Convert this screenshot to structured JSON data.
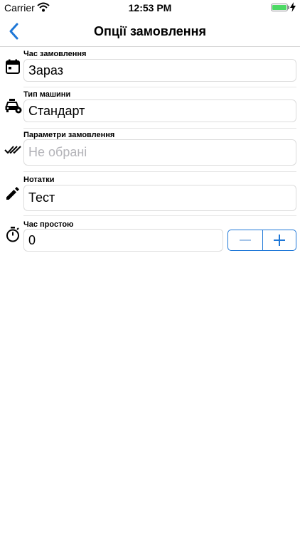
{
  "status_bar": {
    "carrier": "Carrier",
    "time": "12:53 PM"
  },
  "nav": {
    "title": "Опції замовлення",
    "back_icon": "chevron-left-icon"
  },
  "rows": [
    {
      "icon": "calendar-icon",
      "label": "Час замовлення",
      "value": "Зараз"
    },
    {
      "icon": "taxi-settings-icon",
      "label": "Тип машини",
      "value": "Стандарт"
    },
    {
      "icon": "double-check-icon",
      "label": "Параметри замовлення",
      "placeholder": "Не обрані"
    },
    {
      "icon": "pencil-icon",
      "label": "Нотатки",
      "value": "Тест"
    },
    {
      "icon": "stopwatch-icon",
      "label": "Час простою",
      "value": "0"
    }
  ],
  "colors": {
    "accent": "#1e77d7",
    "placeholder": "#b3b3b8",
    "battery": "#4cd964"
  }
}
